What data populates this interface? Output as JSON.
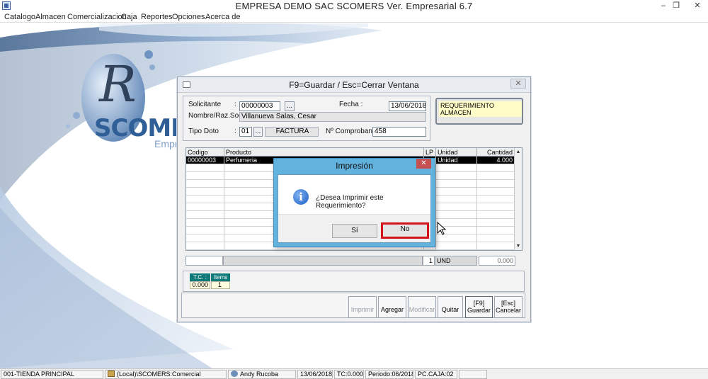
{
  "window": {
    "title": "EMPRESA DEMO SAC        SCOMERS Ver. Empresarial  6.7",
    "minimize": "–",
    "maximize": "❐",
    "close": "✕"
  },
  "menu": [
    "Catalogo",
    "Almacen",
    "Comercializacion",
    "Caja",
    "Reportes",
    "Opciones",
    "Acerca de"
  ],
  "branding": {
    "logo_text": "SCOMER",
    "logo_sub": "Empres"
  },
  "form": {
    "title": "F9=Guardar / Esc=Cerrar Ventana",
    "close": "✕",
    "solicitante_label": "Solicitante",
    "solicitante_colon": ":",
    "solicitante_value": "00000003",
    "browse_label": "...",
    "nombre_label": "Nombre/Raz.Soc. :",
    "nombre_value": "Villanueva  Salas, Cesar",
    "fecha_label": "Fecha :",
    "fecha_value": "13/06/2018",
    "tipodoc_label": "Tipo Doto",
    "tipodoc_colon": ":",
    "tipodoc_code": "01",
    "tipodoc_name": "FACTURA",
    "comprobante_label": "Nº Comprobante :",
    "comprobante_value": "458",
    "doc_type_badge": "REQUERIMIENTO ALMACEN"
  },
  "grid": {
    "headers": [
      "Codigo",
      "Producto",
      "LP",
      "Unidad",
      "Cantidad"
    ],
    "rows": [
      {
        "codigo": "00000003",
        "producto": "Perfumeria",
        "lp": "",
        "unidad": "Unidad",
        "cantidad": "4.000"
      }
    ],
    "scroll_up": "▲",
    "scroll_down": "▼"
  },
  "totals": {
    "lp": "1",
    "unidad": "UND",
    "cantidad": "0.000"
  },
  "tc_panel": {
    "tc_label": "T.C. :",
    "items_label": "Items",
    "tc_value": "0.000",
    "items_value": "1"
  },
  "buttons": {
    "imprimir": "Imprimir",
    "agregar": "Agregar",
    "modificar": "Modificar",
    "quitar": "Quitar",
    "guardar_key": "[F9]",
    "guardar": "Guardar",
    "cancelar_key": "[Esc]",
    "cancelar": "Cancelar"
  },
  "dialog": {
    "title": "Impresión",
    "close": "✕",
    "icon": "i",
    "message": "¿Desea Imprimir este Requerimiento?",
    "yes": "Sí",
    "no": "No"
  },
  "status": {
    "tienda": "001-TIENDA PRINCIPAL",
    "db": "(Local)\\SCOMERS:Comercial",
    "user": "Andy Rucoba",
    "date": "13/06/2018",
    "tc": "TC:0.000",
    "periodo": "Periodo:06/2018",
    "caja": "PC.CAJA:02"
  },
  "colors": {
    "accent": "#0f7a7a",
    "dialog_frame": "#62b2de",
    "focus_border": "#d3141c"
  }
}
